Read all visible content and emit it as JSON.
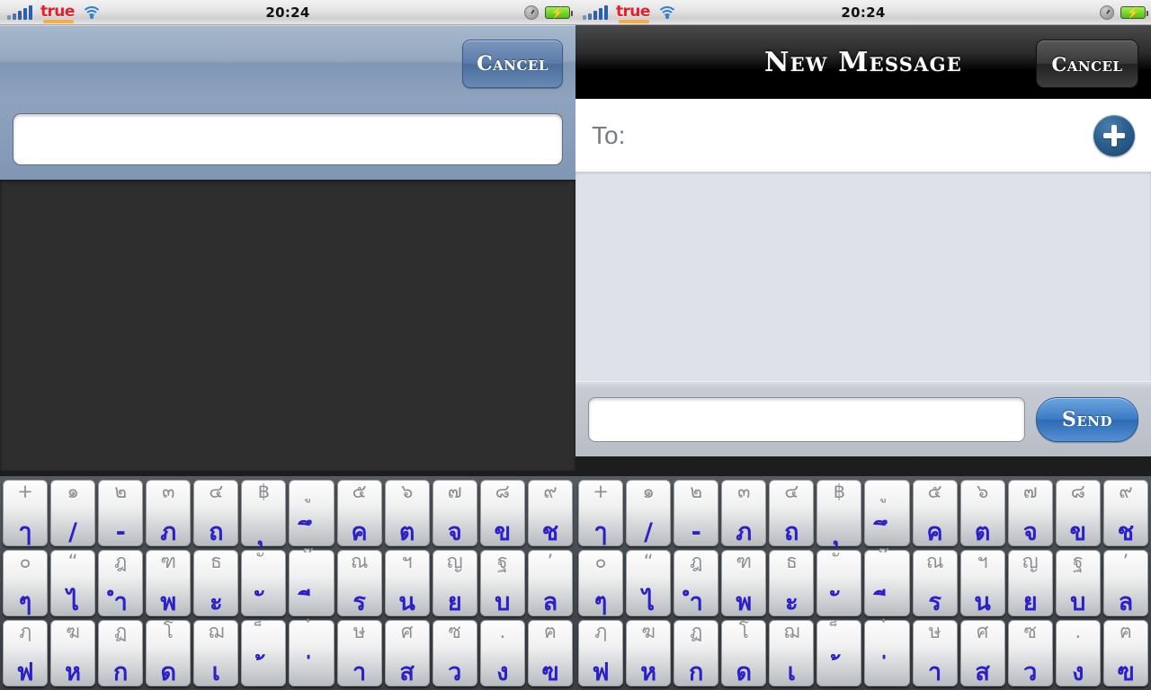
{
  "status_bar": {
    "carrier": "true",
    "time": "20:24",
    "signal_icon": "signal-bars-icon",
    "wifi_icon": "wifi-icon",
    "alarm_icon": "alarm-clock-icon",
    "battery_icon": "battery-charging-icon",
    "signal_bars": 5
  },
  "left_panel": {
    "cancel_label": "Cancel",
    "search_value": "",
    "search_placeholder": "",
    "body_color": "#2e2e2e",
    "navbar_color": "#8097b4"
  },
  "right_panel": {
    "title": "New Message",
    "cancel_label": "Cancel",
    "to_label": "To:",
    "to_value": "",
    "add_contact_icon": "plus-circle-icon",
    "message_area_color": "#dde1ea",
    "compose_value": "",
    "compose_placeholder": "",
    "send_label": "Send",
    "send_color": "#3d7cc4"
  },
  "keyboard": {
    "layout_name": "thai-kedmanee",
    "rows": [
      [
        {
          "upper": "+",
          "lower": "ๅ"
        },
        {
          "upper": "๑",
          "lower": "/"
        },
        {
          "upper": "๒",
          "lower": "-"
        },
        {
          "upper": "๓",
          "lower": "ภ"
        },
        {
          "upper": "๔",
          "lower": "ถ"
        },
        {
          "upper": "฿",
          "lower": "ุ"
        },
        {
          "upper": "ู",
          "lower": "ึ"
        },
        {
          "upper": "๕",
          "lower": "ค"
        },
        {
          "upper": "๖",
          "lower": "ต"
        },
        {
          "upper": "๗",
          "lower": "จ"
        },
        {
          "upper": "๘",
          "lower": "ข"
        },
        {
          "upper": "๙",
          "lower": "ช"
        }
      ],
      [
        {
          "upper": "๐",
          "lower": "ๆ"
        },
        {
          "upper": "“",
          "lower": "ไ"
        },
        {
          "upper": "ฎ",
          "lower": "ำ"
        },
        {
          "upper": "ฑ",
          "lower": "พ"
        },
        {
          "upper": "ธ",
          "lower": "ะ"
        },
        {
          "upper": "ั",
          "lower": "ั"
        },
        {
          "upper": "๊",
          "lower": "ี"
        },
        {
          "upper": "ณ",
          "lower": "ร"
        },
        {
          "upper": "ฯ",
          "lower": "น"
        },
        {
          "upper": "ญ",
          "lower": "ย"
        },
        {
          "upper": "ฐ",
          "lower": "บ"
        },
        {
          "upper": "’",
          "lower": "ล"
        }
      ],
      [
        {
          "upper": "ฦ",
          "lower": "ฟ"
        },
        {
          "upper": "ฆ",
          "lower": "ห"
        },
        {
          "upper": "ฏ",
          "lower": "ก"
        },
        {
          "upper": "โ",
          "lower": "ด"
        },
        {
          "upper": "ฌ",
          "lower": "เ"
        },
        {
          "upper": "็",
          "lower": "้"
        },
        {
          "upper": "๋",
          "lower": "่"
        },
        {
          "upper": "ษ",
          "lower": "า"
        },
        {
          "upper": "ศ",
          "lower": "ส"
        },
        {
          "upper": "ซ",
          "lower": "ว"
        },
        {
          "upper": ".",
          "lower": "ง"
        },
        {
          "upper": "ฅ",
          "lower": "ฃ"
        }
      ]
    ]
  }
}
